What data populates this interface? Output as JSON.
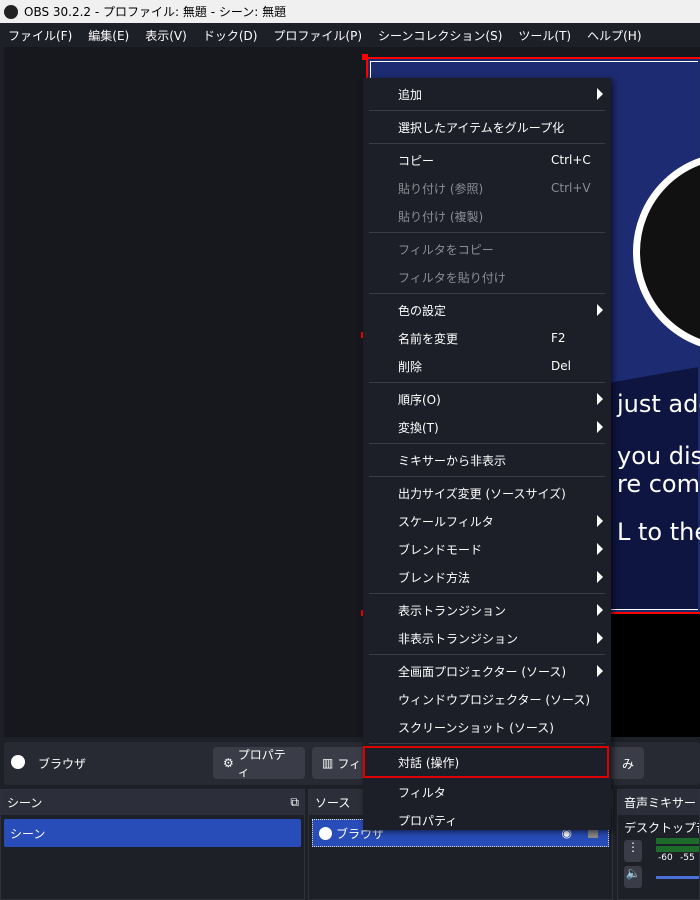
{
  "window": {
    "title": "OBS 30.2.2 - プロファイル: 無題 - シーン: 無題"
  },
  "menubar": [
    "ファイル(F)",
    "編集(E)",
    "表示(V)",
    "ドック(D)",
    "プロファイル(P)",
    "シーンコレクション(S)",
    "ツール(T)",
    "ヘルプ(H)"
  ],
  "preview": {
    "text_fragments": [
      "just add",
      "you disp",
      "re comm",
      "L to the"
    ]
  },
  "context_menu": [
    {
      "label": "追加",
      "submenu": true
    },
    {
      "sep": true
    },
    {
      "label": "選択したアイテムをグループ化"
    },
    {
      "sep": true
    },
    {
      "label": "コピー",
      "shortcut": "Ctrl+C"
    },
    {
      "label": "貼り付け (参照)",
      "shortcut": "Ctrl+V",
      "disabled": true
    },
    {
      "label": "貼り付け (複製)",
      "disabled": true
    },
    {
      "sep": true
    },
    {
      "label": "フィルタをコピー",
      "disabled": true
    },
    {
      "label": "フィルタを貼り付け",
      "disabled": true
    },
    {
      "sep": true
    },
    {
      "label": "色の設定",
      "submenu": true
    },
    {
      "label": "名前を変更",
      "shortcut": "F2"
    },
    {
      "label": "削除",
      "shortcut": "Del"
    },
    {
      "sep": true
    },
    {
      "label": "順序(O)",
      "submenu": true
    },
    {
      "label": "変換(T)",
      "submenu": true
    },
    {
      "sep": true
    },
    {
      "label": "ミキサーから非表示"
    },
    {
      "sep": true
    },
    {
      "label": "出力サイズ変更 (ソースサイズ)"
    },
    {
      "label": "スケールフィルタ",
      "submenu": true
    },
    {
      "label": "ブレンドモード",
      "submenu": true
    },
    {
      "label": "ブレンド方法",
      "submenu": true
    },
    {
      "sep": true
    },
    {
      "label": "表示トランジション",
      "submenu": true
    },
    {
      "label": "非表示トランジション",
      "submenu": true
    },
    {
      "sep": true
    },
    {
      "label": "全画面プロジェクター (ソース)",
      "submenu": true
    },
    {
      "label": "ウィンドウプロジェクター (ソース)"
    },
    {
      "label": "スクリーンショット (ソース)"
    },
    {
      "sep": true
    },
    {
      "label": "対話 (操作)",
      "highlighted": true
    },
    {
      "label": "フィルタ"
    },
    {
      "label": "プロパティ"
    }
  ],
  "toolbar": {
    "source_name": "ブラウザ",
    "properties": "プロパティ",
    "filters": "フィ",
    "other_fragment": "み"
  },
  "scenes": {
    "title": "シーン",
    "items": [
      "シーン"
    ]
  },
  "sources": {
    "title": "ソース",
    "items": [
      "ブラウザ"
    ]
  },
  "mixer": {
    "title": "音声ミキサー",
    "channel": "デスクトップ音声",
    "ticks": [
      "-60",
      "-55"
    ]
  },
  "colors": {
    "selection": "#284cb8",
    "highlight_border": "#dd0000",
    "menu_bg": "#1c1f27"
  }
}
